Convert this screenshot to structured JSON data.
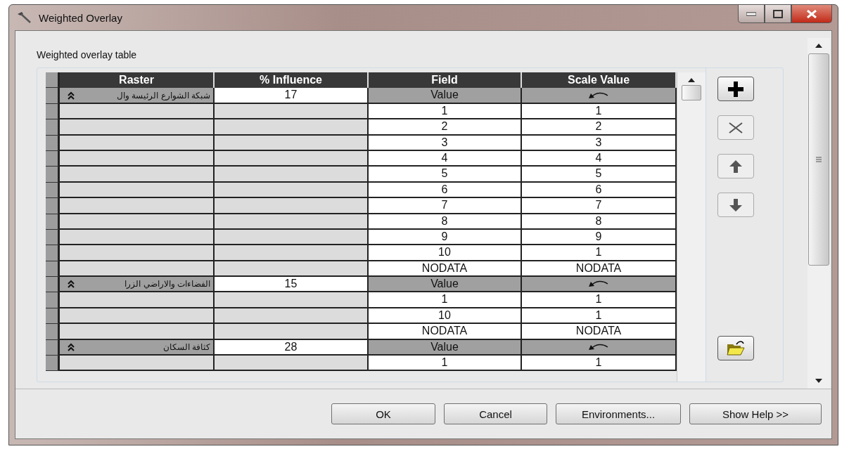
{
  "window": {
    "title": "Weighted Overlay"
  },
  "table_label": "Weighted overlay table",
  "table": {
    "columns": [
      "Raster",
      "% Influence",
      "Field",
      "Scale Value"
    ],
    "groups": [
      {
        "raster": "شبكة الشوارع الرئيسة وال",
        "influence": "17",
        "field": "Value",
        "expanded": true,
        "rows": [
          {
            "field": "1",
            "scale": "1"
          },
          {
            "field": "2",
            "scale": "2"
          },
          {
            "field": "3",
            "scale": "3"
          },
          {
            "field": "4",
            "scale": "4"
          },
          {
            "field": "5",
            "scale": "5"
          },
          {
            "field": "6",
            "scale": "6"
          },
          {
            "field": "7",
            "scale": "7"
          },
          {
            "field": "8",
            "scale": "8"
          },
          {
            "field": "9",
            "scale": "9"
          },
          {
            "field": "10",
            "scale": "1"
          },
          {
            "field": "NODATA",
            "scale": "NODATA"
          }
        ]
      },
      {
        "raster": "الفضاءات والاراضي الزرا",
        "influence": "15",
        "field": "Value",
        "expanded": true,
        "rows": [
          {
            "field": "1",
            "scale": "1"
          },
          {
            "field": "10",
            "scale": "1"
          },
          {
            "field": "NODATA",
            "scale": "NODATA"
          }
        ]
      },
      {
        "raster": "كثافة السكان",
        "influence": "28",
        "field": "Value",
        "expanded": true,
        "rows": [
          {
            "field": "1",
            "scale": "1"
          }
        ]
      }
    ]
  },
  "tools": [
    {
      "kind": "add",
      "disabled": false
    },
    {
      "kind": "remove",
      "disabled": true
    },
    {
      "kind": "up",
      "disabled": true
    },
    {
      "kind": "down",
      "disabled": true
    },
    {
      "kind": "open",
      "disabled": false
    }
  ],
  "buttons": [
    "OK",
    "Cancel",
    "Environments...",
    "Show Help >>"
  ]
}
